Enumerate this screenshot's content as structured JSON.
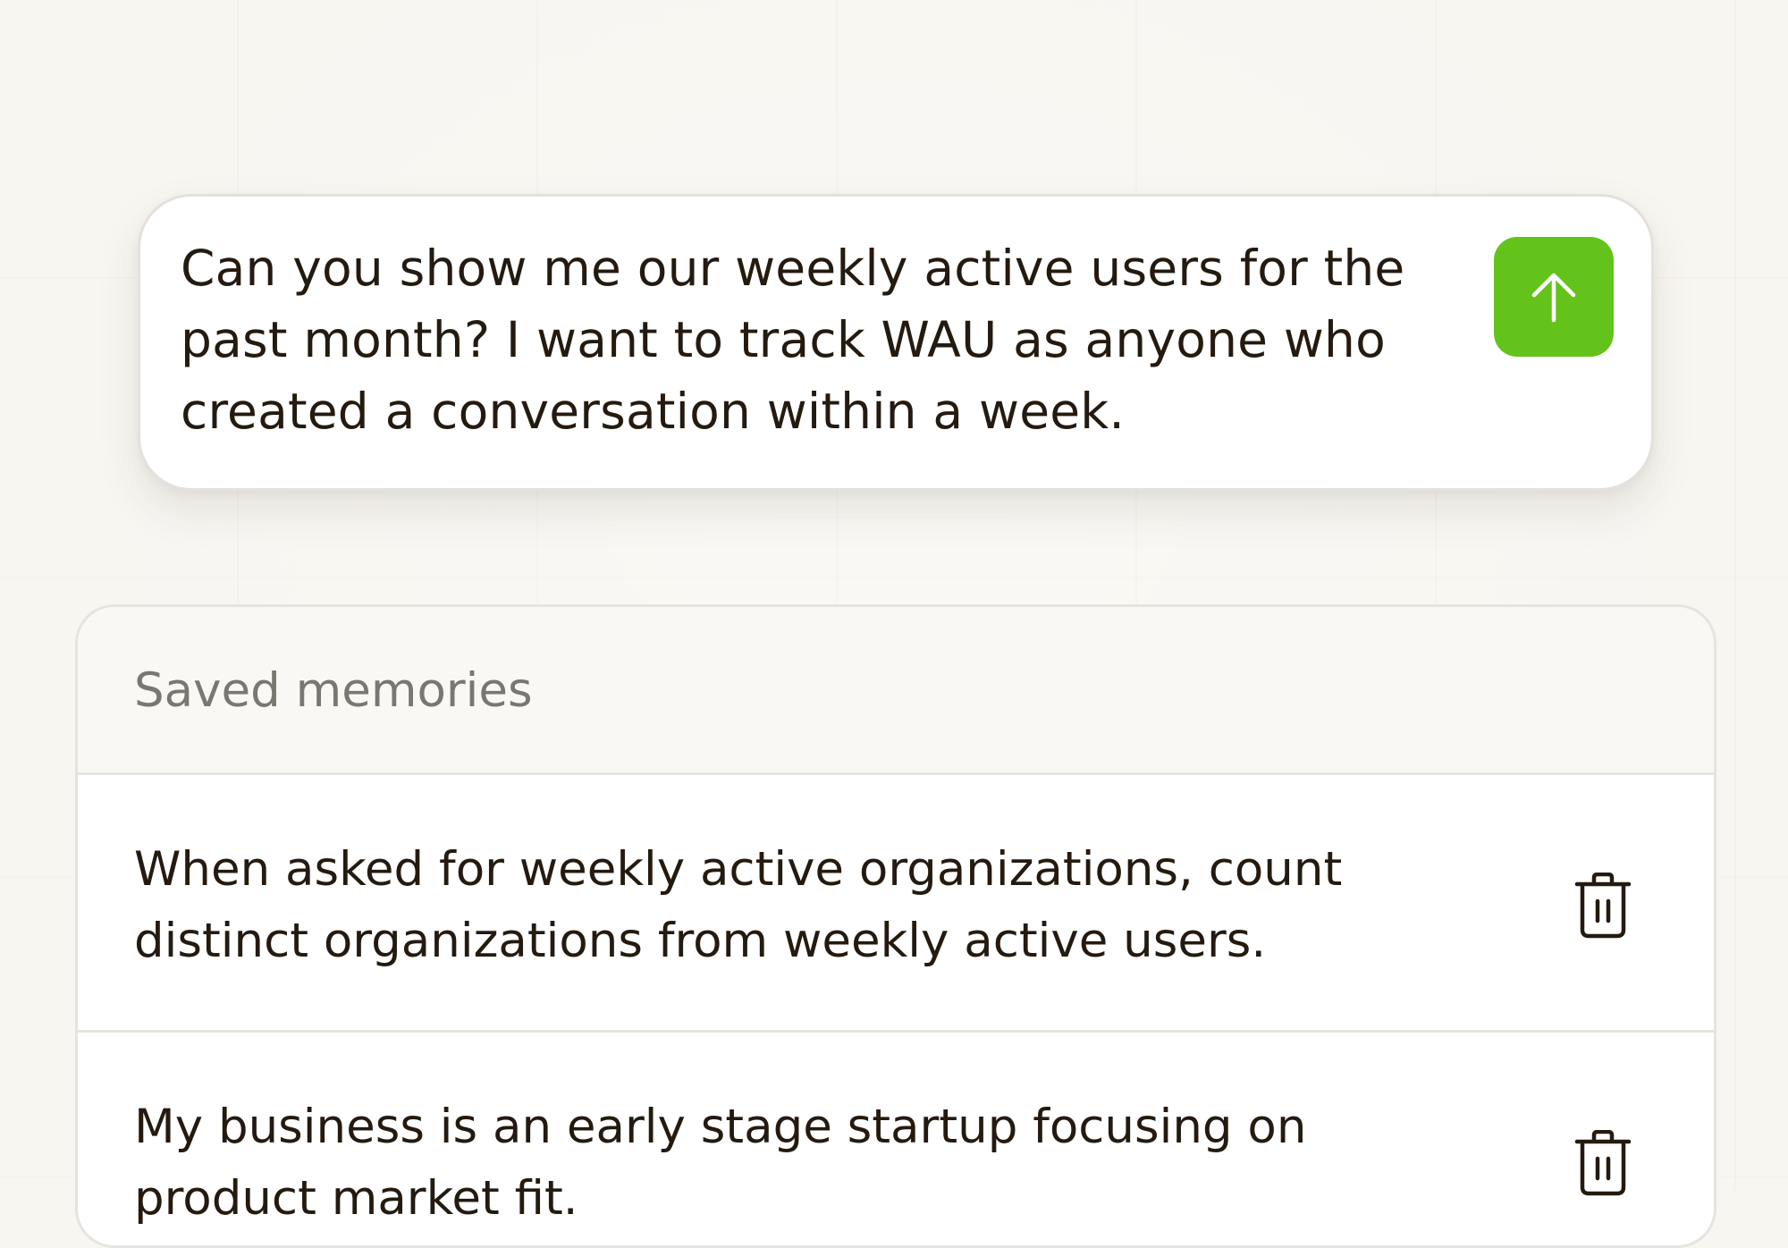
{
  "composer": {
    "message": "Can you show me our weekly active users for the past month? I want to track WAU as anyone who created a conversation within a week.",
    "send_icon": "arrow-up-icon",
    "send_color": "#63c31b"
  },
  "memories": {
    "title": "Saved memories",
    "items": [
      {
        "text": "When asked for weekly active organizations, count distinct organizations from weekly active users.",
        "delete_icon": "trash-icon"
      },
      {
        "text": "My business is an early stage startup focusing on product market fit.",
        "delete_icon": "trash-icon"
      }
    ]
  }
}
